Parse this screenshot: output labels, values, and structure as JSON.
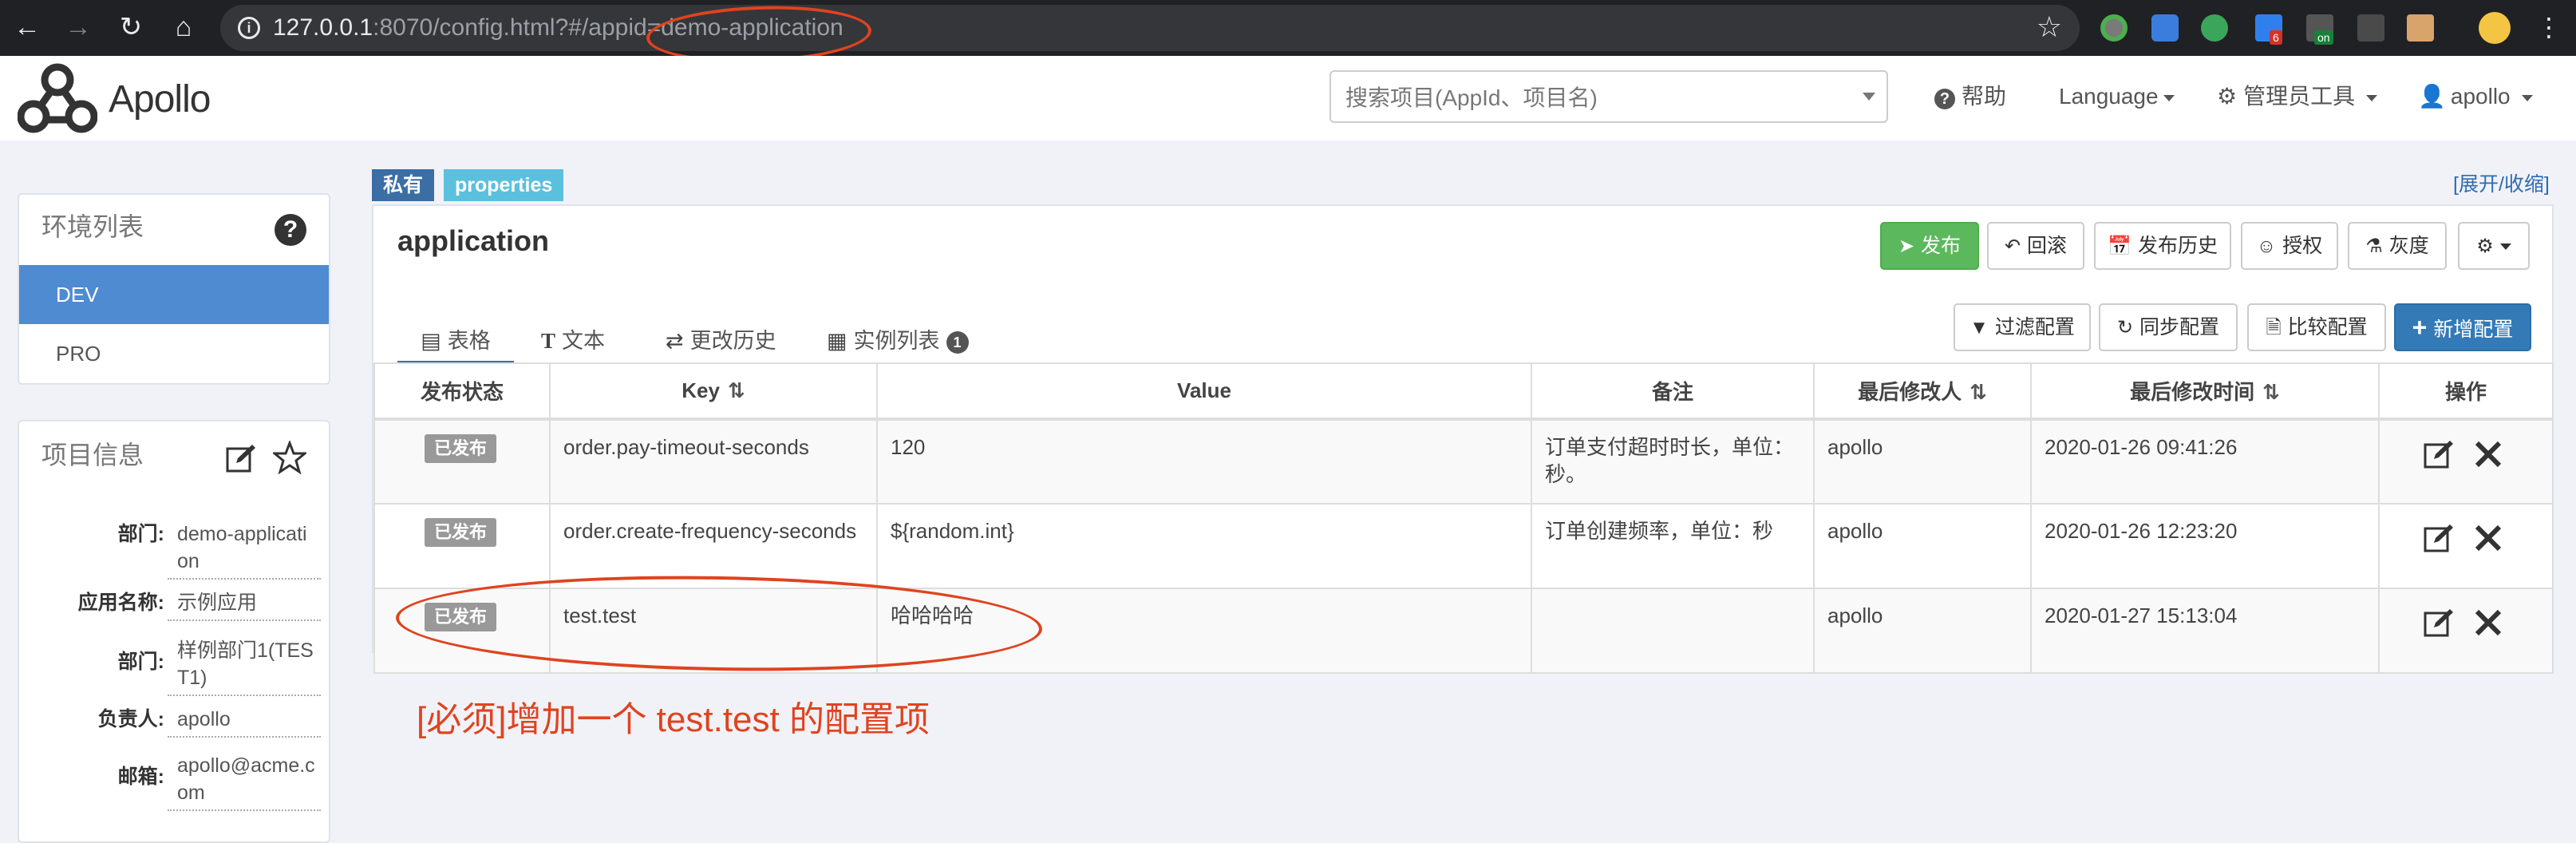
{
  "browser": {
    "url_host": "127.0.0.1",
    "url_rest": ":8070/config.html?#/appid=demo-application",
    "ext_badge_red": "6",
    "ext_badge_green": "on"
  },
  "header": {
    "logo_text": "Apollo",
    "search_placeholder": "搜索项目(AppId、项目名)",
    "help": "帮助",
    "language": "Language",
    "admin_tools": "管理员工具",
    "user": "apollo"
  },
  "sidebar": {
    "env_title": "环境列表",
    "envs": [
      {
        "label": "DEV",
        "active": true
      },
      {
        "label": "PRO",
        "active": false
      }
    ],
    "info_title": "项目信息",
    "info": [
      {
        "label": "部门:",
        "value": "demo-application"
      },
      {
        "label": "应用名称:",
        "value": "示例应用"
      },
      {
        "label": "部门:",
        "value": "样例部门1(TEST1)"
      },
      {
        "label": "负责人:",
        "value": "apollo"
      },
      {
        "label": "邮箱:",
        "value": "apollo@acme.com"
      }
    ]
  },
  "namespace": {
    "tag_private": "私有",
    "tag_format": "properties",
    "expand_toggle": "[展开/收缩]",
    "title": "application",
    "actions": {
      "publish": "发布",
      "rollback": "回滚",
      "history": "发布历史",
      "grant": "授权",
      "gray": "灰度"
    },
    "tabs": [
      {
        "label": "表格",
        "active": true
      },
      {
        "label": "文本",
        "active": false
      },
      {
        "label": "更改历史",
        "active": false
      },
      {
        "label": "实例列表",
        "active": false,
        "badge": "1"
      }
    ],
    "table_actions": {
      "filter": "过滤配置",
      "sync": "同步配置",
      "compare": "比较配置",
      "add": "新增配置"
    },
    "columns": [
      "发布状态",
      "Key",
      "Value",
      "备注",
      "最后修改人",
      "最后修改时间",
      "操作"
    ],
    "rows": [
      {
        "status": "已发布",
        "key": "order.pay-timeout-seconds",
        "value": "120",
        "comment": "订单支付超时时长，单位：秒。",
        "modifier": "apollo",
        "modified": "2020-01-26 09:41:26"
      },
      {
        "status": "已发布",
        "key": "order.create-frequency-seconds",
        "value": "${random.int}",
        "comment": "订单创建频率，单位：秒",
        "modifier": "apollo",
        "modified": "2020-01-26 12:23:20"
      },
      {
        "status": "已发布",
        "key": "test.test",
        "value": "哈哈哈哈",
        "comment": "",
        "modifier": "apollo",
        "modified": "2020-01-27 15:13:04"
      }
    ]
  },
  "annotation": {
    "note": "[必须]增加一个 test.test 的配置项",
    "color": "#e0431f"
  },
  "colors": {
    "primary": "#337ab7",
    "success": "#5cb85c",
    "active_env": "#4f8bd0",
    "tag_private": "#3a6ea5",
    "tag_format": "#5bc0de"
  }
}
